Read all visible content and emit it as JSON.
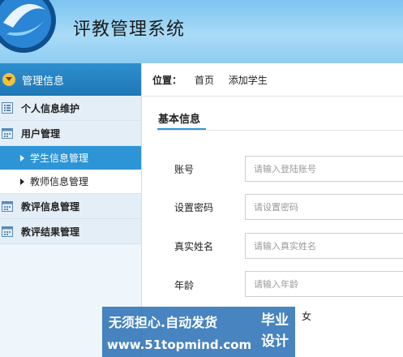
{
  "header": {
    "title": "评教管理系统"
  },
  "sidebar": {
    "head": "管理信息",
    "items": [
      {
        "label": "个人信息维护"
      },
      {
        "label": "用户管理"
      },
      {
        "label": "学生信息管理"
      },
      {
        "label": "教师信息管理"
      },
      {
        "label": "教评信息管理"
      },
      {
        "label": "教评结果管理"
      }
    ]
  },
  "breadcrumb": {
    "label": "位置：",
    "home": "首页",
    "current": "添加学生"
  },
  "tab": {
    "label": "基本信息"
  },
  "form": {
    "account": {
      "label": "账号",
      "placeholder": "请输入登陆账号"
    },
    "password": {
      "label": "设置密码",
      "placeholder": "请设置密码"
    },
    "realname": {
      "label": "真实姓名",
      "placeholder": "请输入真实姓名"
    },
    "age": {
      "label": "年龄",
      "placeholder": "请输入年龄"
    },
    "gender_female": "女"
  },
  "watermark": {
    "line1": "无须担心.自动发货",
    "line2": "www.51topmind.com",
    "badge": "毕业设计"
  }
}
